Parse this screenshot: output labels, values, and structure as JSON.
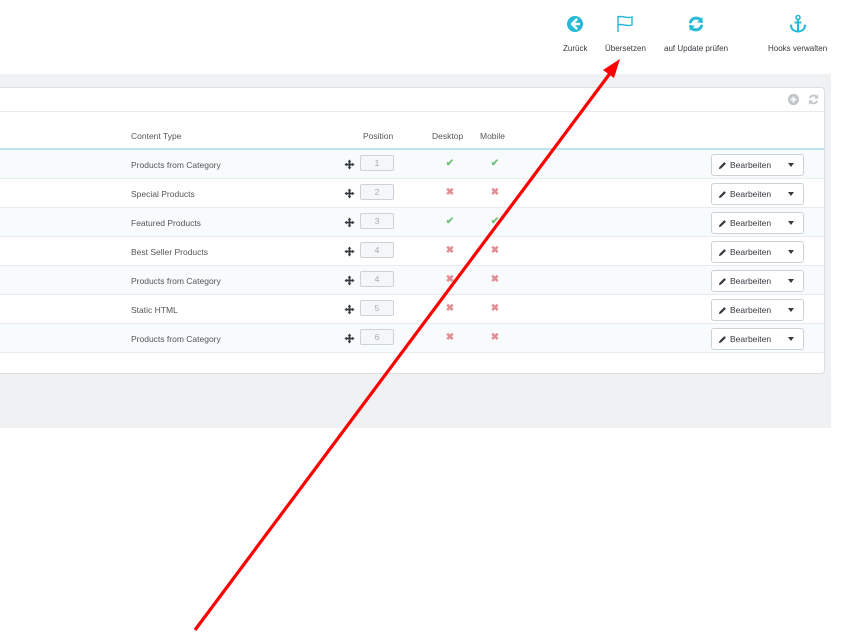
{
  "toolbar": {
    "buttons": [
      {
        "label": "Zurück",
        "icon": "arrow-circle-left-icon"
      },
      {
        "label": "Übersetzen",
        "icon": "flag-icon"
      },
      {
        "label": "auf Update prüfen",
        "icon": "refresh-icon"
      },
      {
        "label": "Hooks verwalten",
        "icon": "anchor-icon"
      }
    ]
  },
  "table": {
    "headers": {
      "content_type": "Content Type",
      "position": "Position",
      "desktop": "Desktop",
      "mobile": "Mobile"
    },
    "rows": [
      {
        "content_type": "Products from Category",
        "position": "1",
        "desktop": true,
        "mobile": true,
        "action": "Bearbeiten"
      },
      {
        "content_type": "Special Products",
        "position": "2",
        "desktop": false,
        "mobile": false,
        "action": "Bearbeiten"
      },
      {
        "content_type": "Featured Products",
        "position": "3",
        "desktop": true,
        "mobile": true,
        "action": "Bearbeiten"
      },
      {
        "content_type": "Best Seller Products",
        "position": "4",
        "desktop": false,
        "mobile": false,
        "action": "Bearbeiten"
      },
      {
        "content_type": "Products from Category",
        "position": "4",
        "desktop": false,
        "mobile": false,
        "action": "Bearbeiten"
      },
      {
        "content_type": "Static HTML",
        "position": "5",
        "desktop": false,
        "mobile": false,
        "action": "Bearbeiten"
      },
      {
        "content_type": "Products from Category",
        "position": "6",
        "desktop": false,
        "mobile": false,
        "action": "Bearbeiten"
      }
    ]
  },
  "colors": {
    "accent": "#25b9d7",
    "check": "#72c279",
    "cross": "#e08f95",
    "annotation_arrow": "#ff0000"
  }
}
